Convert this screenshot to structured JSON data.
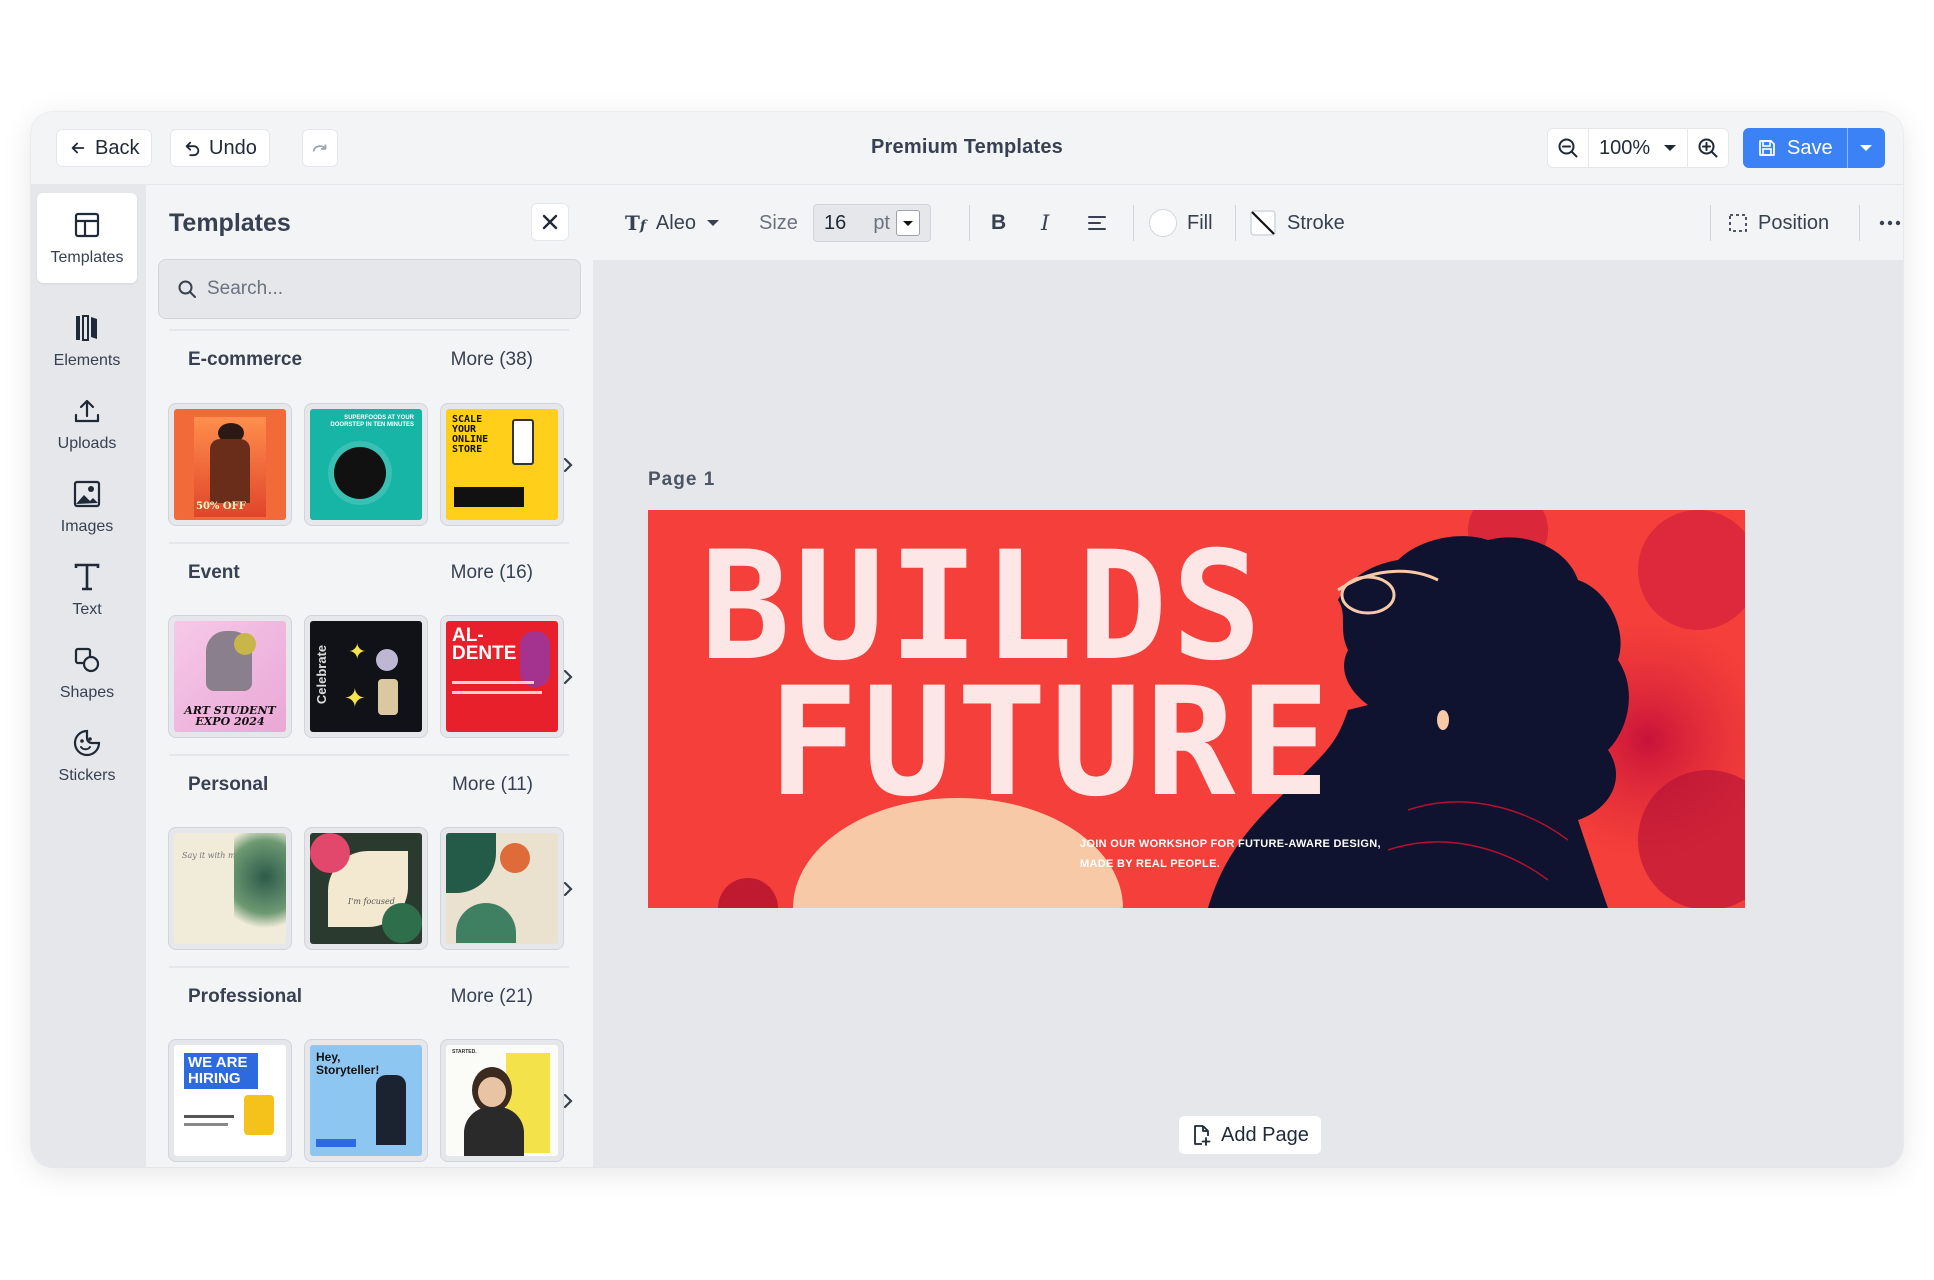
{
  "topbar": {
    "back_label": "Back",
    "undo_label": "Undo",
    "title": "Premium Templates",
    "zoom_value": "100%",
    "save_label": "Save"
  },
  "rail": {
    "items": [
      {
        "label": "Templates",
        "icon": "layout-icon",
        "active": true
      },
      {
        "label": "Elements",
        "icon": "elements-icon"
      },
      {
        "label": "Uploads",
        "icon": "upload-icon"
      },
      {
        "label": "Images",
        "icon": "image-icon"
      },
      {
        "label": "Text",
        "icon": "text-icon"
      },
      {
        "label": "Shapes",
        "icon": "shapes-icon"
      },
      {
        "label": "Stickers",
        "icon": "sticker-icon"
      }
    ]
  },
  "panel": {
    "title": "Templates",
    "search_placeholder": "Search...",
    "categories": [
      {
        "name": "E-commerce",
        "more": "More (38)",
        "thumbs": [
          {
            "label": "fashion-sale",
            "text": "50% OFF"
          },
          {
            "label": "superfoods",
            "text": "SUPERFOODS AT YOUR DOORSTEP IN TEN MINUTES"
          },
          {
            "label": "scale-store",
            "text": "SCALE YOUR ONLINE STORE"
          }
        ]
      },
      {
        "name": "Event",
        "more": "More (16)",
        "thumbs": [
          {
            "label": "art-expo",
            "text": "ART STUDENT EXPO 2024"
          },
          {
            "label": "celebrate",
            "text": "Celebrate"
          },
          {
            "label": "al-dente",
            "text": "AL- DENTE"
          }
        ]
      },
      {
        "name": "Personal",
        "more": "More (11)",
        "thumbs": [
          {
            "label": "floral-1",
            "text": "Say it with me"
          },
          {
            "label": "floral-2",
            "text": "I'm focused"
          },
          {
            "label": "floral-3",
            "text": ""
          }
        ]
      },
      {
        "name": "Professional",
        "more": "More (21)",
        "thumbs": [
          {
            "label": "hiring",
            "text": "WE ARE HIRING"
          },
          {
            "label": "storyteller",
            "text": "Hey, Storyteller!"
          },
          {
            "label": "portrait",
            "text": "STARTED."
          }
        ]
      }
    ]
  },
  "toolbar": {
    "font_name": "Aleo",
    "size_label": "Size",
    "size_value": "16",
    "size_unit": "pt",
    "fill_label": "Fill",
    "stroke_label": "Stroke",
    "position_label": "Position"
  },
  "canvas": {
    "page_label": "Page 1",
    "headline_1": "BUILDS",
    "headline_2": "FUTURE",
    "subtext_1": "JOIN OUR WORKSHOP FOR FUTURE-AWARE DESIGN,",
    "subtext_2": "MADE BY REAL PEOPLE.",
    "add_page_label": "Add Page"
  },
  "colors": {
    "accent": "#3b82f6",
    "banner_red": "#f43f3a",
    "banner_dark": "#0f1330",
    "banner_peach": "#f7c9a7"
  }
}
